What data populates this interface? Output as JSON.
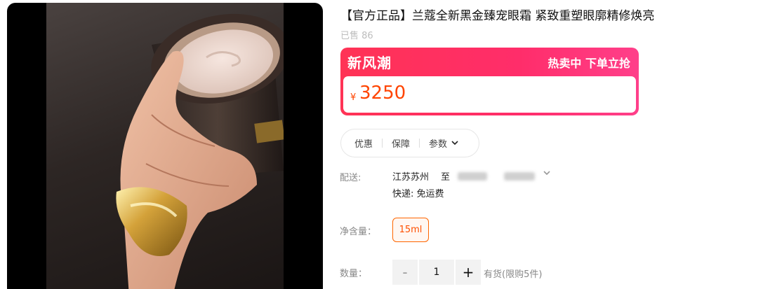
{
  "product": {
    "title": "【官方正品】兰蔻全新黑金臻宠眼霜 紧致重塑眼廓精修焕亮",
    "sold_label": "已售",
    "sold_count": "86",
    "image_icon": "eye-cream-jar-photo"
  },
  "promo": {
    "brand": "新风潮",
    "tagline": "热卖中 下单立抢",
    "currency_symbol": "¥",
    "price": "3250"
  },
  "tabs": {
    "items": [
      "优惠",
      "保障",
      "参数"
    ],
    "dropdown_icon": "chevron-down-icon"
  },
  "shipping": {
    "label": "配送:",
    "origin": "江苏苏州",
    "to": "至",
    "method": "快递: 免运费"
  },
  "spec": {
    "label": "净含量：",
    "option": "15ml"
  },
  "quantity": {
    "label": "数量：",
    "minus": "-",
    "value": "1",
    "plus": "+",
    "stock": "有货(限购5件)"
  },
  "colors": {
    "accent": "#ff4400",
    "promo_start": "#ff3355",
    "promo_end": "#ff3f8a"
  }
}
